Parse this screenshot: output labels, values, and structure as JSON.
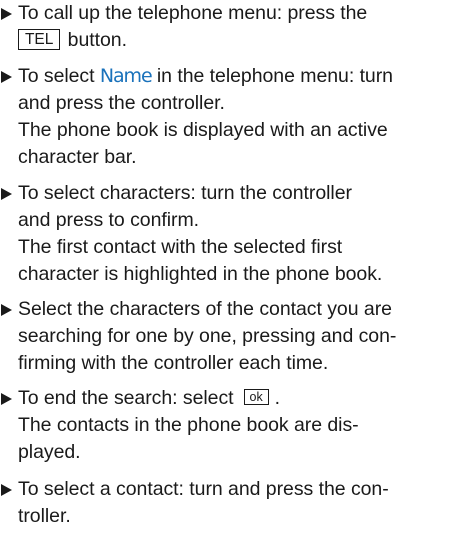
{
  "steps": [
    {
      "lines": [
        {
          "segments": [
            {
              "text": "To call up the telephone menu: press the"
            }
          ]
        },
        {
          "segments": [
            {
              "text": "TEL",
              "kind": "key"
            },
            {
              "text": " button."
            }
          ]
        }
      ]
    },
    {
      "lines": [
        {
          "segments": [
            {
              "text": "To select "
            },
            {
              "text": "Name",
              "kind": "label"
            },
            {
              "text": " in the telephone menu: turn"
            }
          ]
        },
        {
          "segments": [
            {
              "text": "and press the controller."
            }
          ]
        },
        {
          "segments": [
            {
              "text": "The phone book is displayed with an active"
            }
          ]
        },
        {
          "segments": [
            {
              "text": "character bar."
            }
          ]
        }
      ]
    },
    {
      "lines": [
        {
          "segments": [
            {
              "text": "To select characters: turn the controller"
            }
          ]
        },
        {
          "segments": [
            {
              "text": "and press to confirm."
            }
          ]
        },
        {
          "segments": [
            {
              "text": "The first contact with the selected first"
            }
          ]
        },
        {
          "segments": [
            {
              "text": "character is highlighted in the phone book."
            }
          ]
        }
      ]
    },
    {
      "lines": [
        {
          "segments": [
            {
              "text": "Select the characters of the contact you are"
            }
          ]
        },
        {
          "segments": [
            {
              "text": "searching for one by one, pressing and con-"
            }
          ]
        },
        {
          "segments": [
            {
              "text": "firming with the controller each time."
            }
          ]
        }
      ]
    },
    {
      "lines": [
        {
          "segments": [
            {
              "text": "To end the search: select"
            },
            {
              "text": "ok",
              "kind": "key-small"
            },
            {
              "text": "."
            }
          ]
        },
        {
          "segments": [
            {
              "text": "The contacts in the phone book are dis-"
            }
          ]
        },
        {
          "segments": [
            {
              "text": "played."
            }
          ]
        }
      ]
    },
    {
      "lines": [
        {
          "segments": [
            {
              "text": "To select a contact: turn and press the con-"
            }
          ]
        },
        {
          "segments": [
            {
              "text": "troller."
            }
          ]
        }
      ]
    }
  ]
}
